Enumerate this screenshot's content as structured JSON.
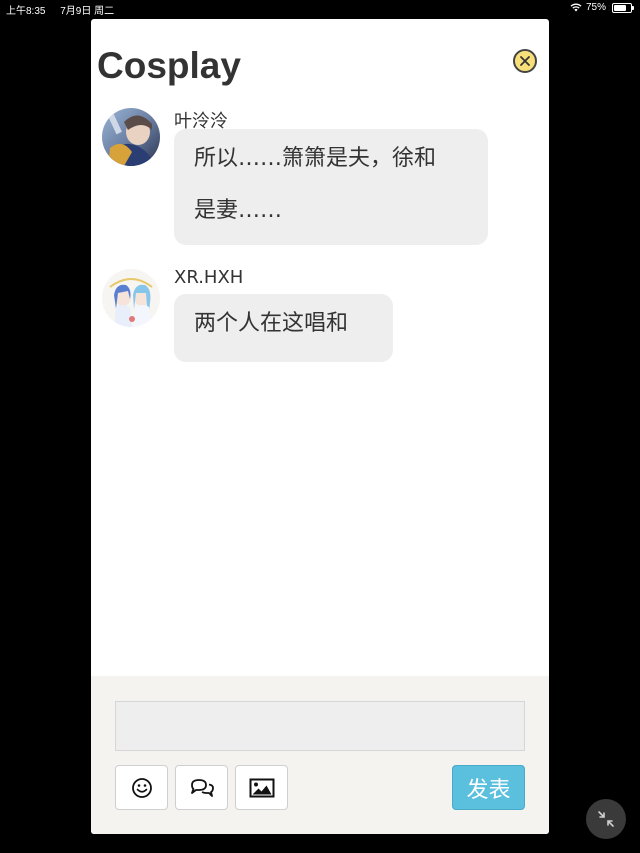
{
  "status_bar": {
    "time": "上午8:35",
    "date": "7月9日 周二",
    "battery_text": "75%",
    "battery_level": 0.75
  },
  "panel": {
    "title": "Cosplay"
  },
  "messages": [
    {
      "user": "叶泠泠",
      "line1": "所以……箫箫是夫，徐和",
      "line2": "是妻……"
    },
    {
      "user": "XR.HXH",
      "line1": "两个人在这唱和"
    }
  ],
  "composer": {
    "input_value": "",
    "send_label": "发表"
  },
  "colors": {
    "send_button": "#5bbfde",
    "close_button": "#f7e07a",
    "bubble": "#eeeeee",
    "composer_bg": "#f4f3ef"
  }
}
